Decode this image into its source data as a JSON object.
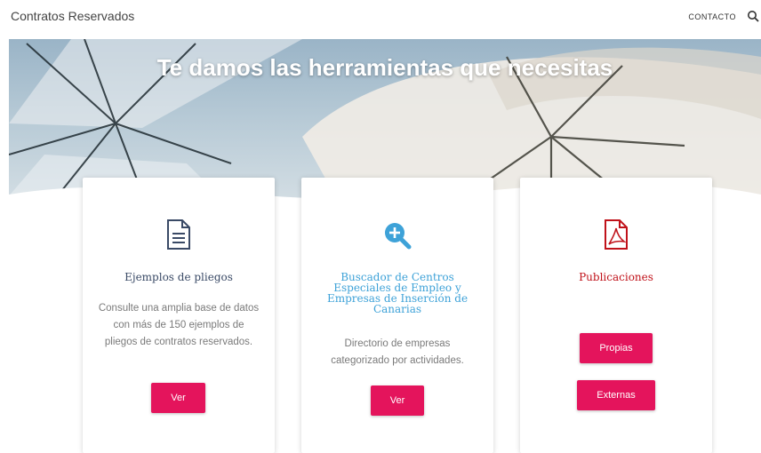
{
  "header": {
    "brand": "Contratos Reservados",
    "nav_contact": "CONTACTO",
    "search_icon": "search-icon"
  },
  "hero": {
    "title": "Te damos las herramientas que necesitas"
  },
  "cards": [
    {
      "icon": "document-icon",
      "title": "Ejemplos de pliegos",
      "title_color": "#3a4a66",
      "description": "Consulte una amplia base de datos con más de 150 ejemplos de pliegos de contratos reservados.",
      "buttons": [
        "Ver"
      ]
    },
    {
      "icon": "zoom-in-icon",
      "title": "Buscador de Centros Especiales de Empleo y Empresas de Inserción de Canarias",
      "title_color": "#3ea2d8",
      "description": "Directorio de empresas categorizado por actividades.",
      "buttons": [
        "Ver"
      ]
    },
    {
      "icon": "pdf-icon",
      "title": "Publicaciones",
      "title_color": "#c0121a",
      "description": "",
      "buttons": [
        "Propias",
        "Externas"
      ]
    }
  ],
  "colors": {
    "button": "#e4145c",
    "hero_text": "#ffffff"
  }
}
